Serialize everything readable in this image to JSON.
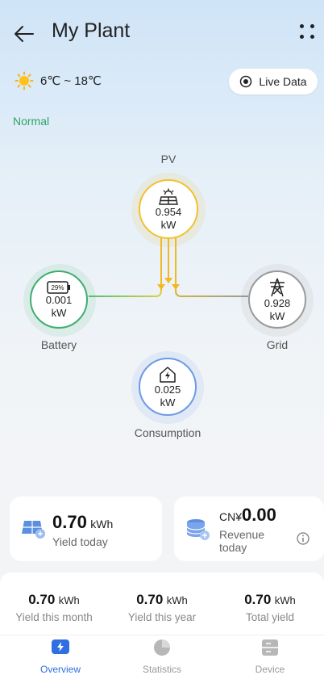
{
  "header": {
    "title": "My Plant"
  },
  "weather": {
    "temp_range": "6℃ ~ 18℃",
    "icon": "sun-icon"
  },
  "live_button": {
    "label": "Live Data"
  },
  "status": {
    "text": "Normal",
    "color": "#2ea36a"
  },
  "flow": {
    "pv": {
      "label": "PV",
      "value": "0.954",
      "unit": "kW"
    },
    "battery": {
      "label": "Battery",
      "value": "0.001",
      "unit": "kW",
      "soc": "29%"
    },
    "grid": {
      "label": "Grid",
      "value": "0.928",
      "unit": "kW"
    },
    "consumption": {
      "label": "Consumption",
      "value": "0.025",
      "unit": "kW"
    }
  },
  "cards": {
    "yield_today": {
      "value": "0.70",
      "unit": "kWh",
      "label": "Yield today"
    },
    "revenue_today": {
      "currency": "CN¥",
      "value": "0.00",
      "label_line1": "Revenue",
      "label_line2": "today"
    }
  },
  "summary": [
    {
      "value": "0.70",
      "unit": "kWh",
      "label": "Yield this month"
    },
    {
      "value": "0.70",
      "unit": "kWh",
      "label": "Yield this year"
    },
    {
      "value": "0.70",
      "unit": "kWh",
      "label": "Total yield"
    }
  ],
  "tabs": [
    {
      "label": "Overview",
      "active": true
    },
    {
      "label": "Statistics",
      "active": false
    },
    {
      "label": "Device",
      "active": false
    }
  ],
  "colors": {
    "accent": "#2f6fe0",
    "pv": "#f2c12e",
    "battery": "#3fae6e",
    "grid": "#8a8a8a",
    "consumption": "#6b9be6"
  }
}
